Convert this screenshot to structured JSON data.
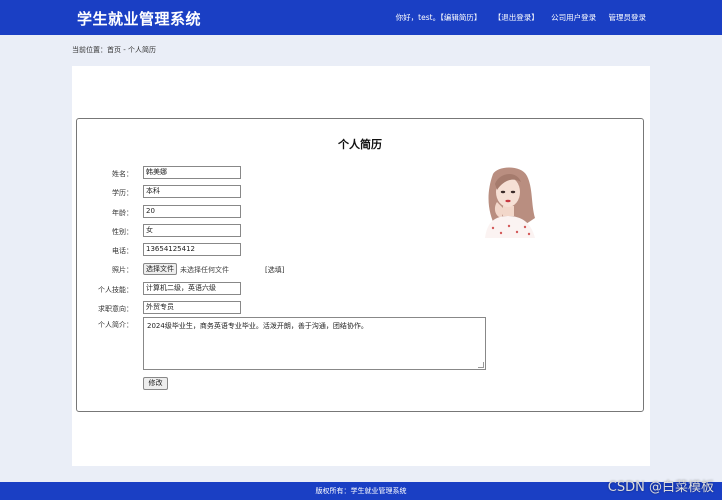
{
  "header": {
    "site_title": "学生就业管理系统",
    "greeting": "你好，test。",
    "nav_edit_resume": "【编辑简历】",
    "nav_logout": "【退出登录】",
    "nav_company_login": "公司用户登录",
    "nav_admin_login": "管理员登录"
  },
  "breadcrumb": "当前位置：首页 - 个人简历",
  "form": {
    "title": "个人简历",
    "name_label": "姓名：",
    "name_value": "韩美娜",
    "education_label": "学历：",
    "education_value": "本科",
    "age_label": "年龄：",
    "age_value": "20",
    "gender_label": "性别：",
    "gender_value": "女",
    "phone_label": "电话：",
    "phone_value": "13654125412",
    "photo_label": "照片：",
    "file_button": "选择文件",
    "file_status": "未选择任何文件",
    "pick_link": "[选填]",
    "skills_label": "个人技能：",
    "skills_value": "计算机二级，英语六级",
    "intention_label": "求职意向：",
    "intention_value": "外贸专员",
    "intro_label": "个人简介：",
    "intro_value": "2024级毕业生，商务英语专业毕业。活泼开朗，善于沟通，团结协作。",
    "submit": "修改"
  },
  "footer": "版权所有：学生就业管理系统",
  "watermark": "CSDN @白菜模板"
}
